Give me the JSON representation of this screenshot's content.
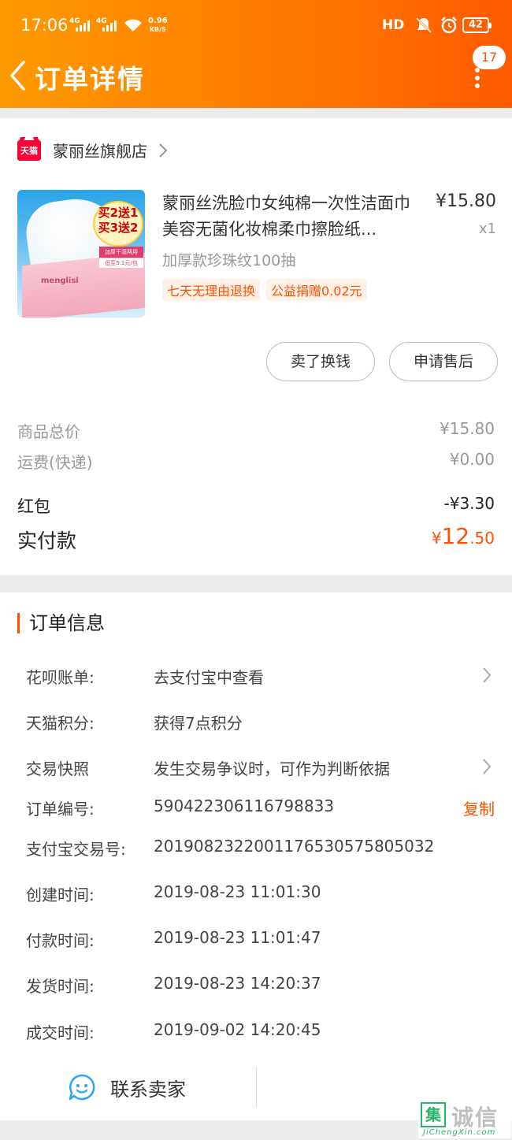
{
  "status_bar": {
    "time": "17:06",
    "net1": "4G",
    "net2": "4G",
    "speed_value": "0.96",
    "speed_unit": "KB/S",
    "hd": "HD",
    "battery": "42"
  },
  "nav": {
    "title": "订单详情",
    "message_count": "17"
  },
  "store": {
    "badge": "天猫",
    "name": "蒙丽丝旗舰店"
  },
  "product": {
    "title": "蒙丽丝洗脸巾女纯棉一次性洁面巾美容无菌化妆棉柔巾擦脸纸...",
    "price": "¥15.80",
    "quantity": "x1",
    "sku": "加厚款珍珠纹100抽",
    "tags": [
      "七天无理由退换",
      "公益捐赠0.02元"
    ],
    "image_text": {
      "promo_line1": "买2送1",
      "promo_line2": "买3送2",
      "strip1": "加厚干湿两用",
      "strip2": "低至5.1元/包",
      "box_brand": "menglisi"
    }
  },
  "actions": {
    "sell": "卖了换钱",
    "after_sale": "申请售后"
  },
  "fees": {
    "goods_total_label": "商品总价",
    "goods_total_value": "¥15.80",
    "shipping_label": "运费(快递)",
    "shipping_value": "¥0.00",
    "red_packet_label": "红包",
    "red_packet_value": "-¥3.30",
    "paid_label": "实付款",
    "paid_currency": "¥",
    "paid_int": "12",
    "paid_dec": ".50"
  },
  "order_info": {
    "title": "订单信息",
    "rows": [
      {
        "label": "花呗账单:",
        "value": "去支付宝中查看"
      },
      {
        "label": "天猫积分:",
        "value": "获得7点积分"
      },
      {
        "label": "交易快照",
        "value": "发生交易争议时，可作为判断依据"
      },
      {
        "label": "订单编号:",
        "value": "590422306116798833"
      },
      {
        "label": "支付宝交易号:",
        "value": "2019082322001176530575805032"
      },
      {
        "label": "创建时间:",
        "value": "2019-08-23 11:01:30"
      },
      {
        "label": "付款时间:",
        "value": "2019-08-23 11:01:47"
      },
      {
        "label": "发货时间:",
        "value": "2019-08-23 14:20:37"
      },
      {
        "label": "成交时间:",
        "value": "2019-09-02 14:20:45"
      }
    ],
    "copy_label": "复制"
  },
  "contact": {
    "label": "联系卖家"
  },
  "watermark": {
    "cn": "诚信",
    "box": "集",
    "en": "JiChengXin.com"
  },
  "colors": {
    "accent": "#ff5000",
    "header_start": "#ff9a00",
    "header_end": "#ff5a00",
    "tmall_red": "#ff0036"
  }
}
